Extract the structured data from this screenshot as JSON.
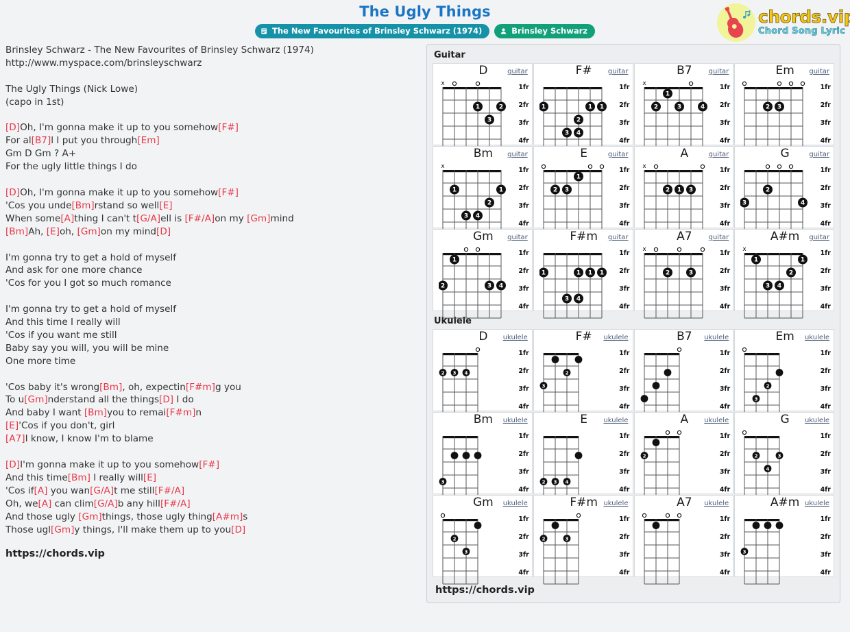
{
  "header": {
    "song_title": "The Ugly Things",
    "album_badge": "The New Favourites of Brinsley Schwarz (1974)",
    "artist_badge": "Brinsley Schwarz",
    "logo_name": "chords.vip",
    "logo_sub": "Chord Song Lyric"
  },
  "lyrics": {
    "footer_url": "https://chords.vip",
    "lines": [
      [
        {
          "t": "Brinsley Schwarz - The New Favourites of Brinsley Schwarz (1974)",
          "c": false
        }
      ],
      [
        {
          "t": "http://www.myspace.com/brinsleyschwarz",
          "c": false
        }
      ],
      [],
      [
        {
          "t": "The Ugly Things (Nick Lowe)",
          "c": false
        }
      ],
      [
        {
          "t": "(capo in 1st)",
          "c": false
        }
      ],
      [],
      [
        {
          "t": "[D]",
          "c": true
        },
        {
          "t": "Oh, I'm gonna make it up to you somehow",
          "c": false
        },
        {
          "t": "[F#]",
          "c": true
        }
      ],
      [
        {
          "t": "For al",
          "c": false
        },
        {
          "t": "[B7]",
          "c": true
        },
        {
          "t": "l I put you through",
          "c": false
        },
        {
          "t": "[Em]",
          "c": true
        }
      ],
      [
        {
          "t": "Gm D Gm ? A+",
          "c": false
        }
      ],
      [
        {
          "t": "For the ugly little things I do",
          "c": false
        }
      ],
      [],
      [
        {
          "t": "[D]",
          "c": true
        },
        {
          "t": "Oh, I'm gonna make it up to you somehow",
          "c": false
        },
        {
          "t": "[F#]",
          "c": true
        }
      ],
      [
        {
          "t": "'Cos you unde",
          "c": false
        },
        {
          "t": "[Bm]",
          "c": true
        },
        {
          "t": "rstand so well",
          "c": false
        },
        {
          "t": "[E]",
          "c": true
        }
      ],
      [
        {
          "t": "When some",
          "c": false
        },
        {
          "t": "[A]",
          "c": true
        },
        {
          "t": "thing I can't t",
          "c": false
        },
        {
          "t": "[G/A]",
          "c": true
        },
        {
          "t": "ell is ",
          "c": false
        },
        {
          "t": "[F#/A]",
          "c": true
        },
        {
          "t": "on my ",
          "c": false
        },
        {
          "t": "[Gm]",
          "c": true
        },
        {
          "t": "mind",
          "c": false
        }
      ],
      [
        {
          "t": "[Bm]",
          "c": true
        },
        {
          "t": "Ah, ",
          "c": false
        },
        {
          "t": "[E]",
          "c": true
        },
        {
          "t": "oh, ",
          "c": false
        },
        {
          "t": "[Gm]",
          "c": true
        },
        {
          "t": "on my mind",
          "c": false
        },
        {
          "t": "[D]",
          "c": true
        }
      ],
      [],
      [
        {
          "t": "I'm gonna try to get a hold of myself",
          "c": false
        }
      ],
      [
        {
          "t": "And ask for one more chance",
          "c": false
        }
      ],
      [
        {
          "t": "'Cos for you I got so much romance",
          "c": false
        }
      ],
      [],
      [
        {
          "t": "I'm gonna try to get a hold of myself",
          "c": false
        }
      ],
      [
        {
          "t": "And this time I really will",
          "c": false
        }
      ],
      [
        {
          "t": "'Cos if you want me still",
          "c": false
        }
      ],
      [
        {
          "t": "Baby say you will, you will be mine",
          "c": false
        }
      ],
      [
        {
          "t": "One more time",
          "c": false
        }
      ],
      [],
      [
        {
          "t": "'Cos baby it's wrong",
          "c": false
        },
        {
          "t": "[Bm]",
          "c": true
        },
        {
          "t": ", oh, expectin",
          "c": false
        },
        {
          "t": "[F#m]",
          "c": true
        },
        {
          "t": "g you",
          "c": false
        }
      ],
      [
        {
          "t": "To u",
          "c": false
        },
        {
          "t": "[Gm]",
          "c": true
        },
        {
          "t": "nderstand all the things",
          "c": false
        },
        {
          "t": "[D]",
          "c": true
        },
        {
          "t": " I do",
          "c": false
        }
      ],
      [
        {
          "t": "And baby I want ",
          "c": false
        },
        {
          "t": "[Bm]",
          "c": true
        },
        {
          "t": "you to remai",
          "c": false
        },
        {
          "t": "[F#m]",
          "c": true
        },
        {
          "t": "n",
          "c": false
        }
      ],
      [
        {
          "t": "[E]",
          "c": true
        },
        {
          "t": "'Cos if you don't, girl",
          "c": false
        }
      ],
      [
        {
          "t": "[A7]",
          "c": true
        },
        {
          "t": "I know, I know I'm to blame",
          "c": false
        }
      ],
      [],
      [
        {
          "t": "[D]",
          "c": true
        },
        {
          "t": "I'm gonna make it up to you somehow",
          "c": false
        },
        {
          "t": "[F#]",
          "c": true
        }
      ],
      [
        {
          "t": "And this time",
          "c": false
        },
        {
          "t": "[Bm]",
          "c": true
        },
        {
          "t": " I really will",
          "c": false
        },
        {
          "t": "[E]",
          "c": true
        }
      ],
      [
        {
          "t": "'Cos if",
          "c": false
        },
        {
          "t": "[A]",
          "c": true
        },
        {
          "t": " you wan",
          "c": false
        },
        {
          "t": "[G/A]",
          "c": true
        },
        {
          "t": "t me still",
          "c": false
        },
        {
          "t": "[F#/A]",
          "c": true
        }
      ],
      [
        {
          "t": "Oh, we",
          "c": false
        },
        {
          "t": "[A]",
          "c": true
        },
        {
          "t": " can clim",
          "c": false
        },
        {
          "t": "[G/A]",
          "c": true
        },
        {
          "t": "b any hill",
          "c": false
        },
        {
          "t": "[F#/A]",
          "c": true
        }
      ],
      [
        {
          "t": "And those ugly ",
          "c": false
        },
        {
          "t": "[Gm]",
          "c": true
        },
        {
          "t": "things, those ugly thing",
          "c": false
        },
        {
          "t": "[A#m]",
          "c": true
        },
        {
          "t": "s",
          "c": false
        }
      ],
      [
        {
          "t": "Those ugl",
          "c": false
        },
        {
          "t": "[Gm]",
          "c": true
        },
        {
          "t": "y things, I'll make them up to you",
          "c": false
        },
        {
          "t": "[D]",
          "c": true
        }
      ]
    ]
  },
  "chords": {
    "guitar_label": "Guitar",
    "ukulele_label": "Ukulele",
    "guitar_tag": "guitar",
    "ukulele_tag": "ukulele",
    "fret_labels": [
      "1fr",
      "2fr",
      "3fr",
      "4fr"
    ],
    "footer_url": "https://chords.vip",
    "guitar": [
      {
        "name": "D",
        "open": [
          "x",
          "o",
          "",
          "o",
          "",
          ""
        ],
        "dots": [
          {
            "s": 3,
            "f": 2,
            "n": "1"
          },
          {
            "s": 5,
            "f": 2,
            "n": "2"
          },
          {
            "s": 4,
            "f": 3,
            "n": "3"
          }
        ]
      },
      {
        "name": "F#",
        "open": [
          "",
          "",
          "",
          "",
          "",
          ""
        ],
        "dots": [
          {
            "s": 0,
            "f": 2,
            "n": "1"
          },
          {
            "s": 4,
            "f": 2,
            "n": "1"
          },
          {
            "s": 5,
            "f": 2,
            "n": "1"
          },
          {
            "s": 3,
            "f": 3,
            "n": "2"
          },
          {
            "s": 2,
            "f": 4,
            "n": "3"
          },
          {
            "s": 3,
            "f": 4,
            "n": "4"
          }
        ]
      },
      {
        "name": "B7",
        "open": [
          "x",
          "",
          "",
          "",
          "o",
          ""
        ],
        "dots": [
          {
            "s": 2,
            "f": 1,
            "n": "1"
          },
          {
            "s": 1,
            "f": 2,
            "n": "2"
          },
          {
            "s": 3,
            "f": 2,
            "n": "3"
          },
          {
            "s": 5,
            "f": 2,
            "n": "4"
          }
        ]
      },
      {
        "name": "Em",
        "open": [
          "o",
          "",
          "",
          "o",
          "o",
          "o"
        ],
        "dots": [
          {
            "s": 2,
            "f": 2,
            "n": "2"
          },
          {
            "s": 3,
            "f": 2,
            "n": "3"
          }
        ]
      },
      {
        "name": "Bm",
        "open": [
          "x",
          "",
          "",
          "",
          "",
          ""
        ],
        "dots": [
          {
            "s": 1,
            "f": 2,
            "n": "1"
          },
          {
            "s": 5,
            "f": 2,
            "n": "1"
          },
          {
            "s": 4,
            "f": 3,
            "n": "2"
          },
          {
            "s": 2,
            "f": 4,
            "n": "3"
          },
          {
            "s": 3,
            "f": 4,
            "n": "4"
          }
        ]
      },
      {
        "name": "E",
        "open": [
          "o",
          "",
          "",
          "",
          "o",
          "o"
        ],
        "dots": [
          {
            "s": 3,
            "f": 1,
            "n": "1"
          },
          {
            "s": 1,
            "f": 2,
            "n": "2"
          },
          {
            "s": 2,
            "f": 2,
            "n": "3"
          }
        ]
      },
      {
        "name": "A",
        "open": [
          "x",
          "o",
          "",
          "",
          "",
          "o"
        ],
        "dots": [
          {
            "s": 2,
            "f": 2,
            "n": "2"
          },
          {
            "s": 3,
            "f": 2,
            "n": "1"
          },
          {
            "s": 4,
            "f": 2,
            "n": "3"
          }
        ]
      },
      {
        "name": "G",
        "open": [
          "",
          "",
          "o",
          "o",
          "o",
          ""
        ],
        "dots": [
          {
            "s": 2,
            "f": 2,
            "n": "2"
          },
          {
            "s": 0,
            "f": 3,
            "n": "3"
          },
          {
            "s": 5,
            "f": 3,
            "n": "4"
          }
        ]
      },
      {
        "name": "Gm",
        "open": [
          "",
          "",
          "o",
          "o",
          "",
          ""
        ],
        "dots": [
          {
            "s": 1,
            "f": 1,
            "n": "1"
          },
          {
            "s": 0,
            "f": 3,
            "n": "2"
          },
          {
            "s": 4,
            "f": 3,
            "n": "3"
          },
          {
            "s": 5,
            "f": 3,
            "n": "4"
          }
        ]
      },
      {
        "name": "F#m",
        "open": [
          "",
          "",
          "",
          "",
          "",
          ""
        ],
        "dots": [
          {
            "s": 0,
            "f": 2,
            "n": "1"
          },
          {
            "s": 3,
            "f": 2,
            "n": "1"
          },
          {
            "s": 4,
            "f": 2,
            "n": "1"
          },
          {
            "s": 5,
            "f": 2,
            "n": "1"
          },
          {
            "s": 2,
            "f": 4,
            "n": "3"
          },
          {
            "s": 3,
            "f": 4,
            "n": "4"
          }
        ]
      },
      {
        "name": "A7",
        "open": [
          "x",
          "o",
          "",
          "o",
          "",
          "o"
        ],
        "dots": [
          {
            "s": 2,
            "f": 2,
            "n": "2"
          },
          {
            "s": 4,
            "f": 2,
            "n": "3"
          }
        ]
      },
      {
        "name": "A#m",
        "open": [
          "x",
          "",
          "",
          "",
          "",
          ""
        ],
        "dots": [
          {
            "s": 1,
            "f": 1,
            "n": "1"
          },
          {
            "s": 5,
            "f": 1,
            "n": "1"
          },
          {
            "s": 4,
            "f": 2,
            "n": "2"
          },
          {
            "s": 2,
            "f": 3,
            "n": "3"
          },
          {
            "s": 3,
            "f": 3,
            "n": "4"
          }
        ]
      }
    ],
    "ukulele": [
      {
        "name": "D",
        "open": [
          "",
          "",
          "",
          "o"
        ],
        "dots": [
          {
            "s": 0,
            "f": 2,
            "n": "2"
          },
          {
            "s": 1,
            "f": 2,
            "n": "3"
          },
          {
            "s": 2,
            "f": 2,
            "n": "4"
          }
        ]
      },
      {
        "name": "F#",
        "open": [
          "",
          "",
          "",
          ""
        ],
        "dots": [
          {
            "s": 1,
            "f": 1,
            "n": ""
          },
          {
            "s": 3,
            "f": 1,
            "n": ""
          },
          {
            "s": 2,
            "f": 2,
            "n": "2"
          },
          {
            "s": 0,
            "f": 3,
            "n": "3"
          }
        ]
      },
      {
        "name": "B7",
        "open": [
          "",
          "",
          "",
          "o"
        ],
        "dots": [
          {
            "s": 2,
            "f": 2,
            "n": ""
          },
          {
            "s": 1,
            "f": 3,
            "n": ""
          },
          {
            "s": 0,
            "f": 4,
            "n": ""
          }
        ]
      },
      {
        "name": "Em",
        "open": [
          "o",
          "",
          "",
          ""
        ],
        "dots": [
          {
            "s": 3,
            "f": 2,
            "n": ""
          },
          {
            "s": 2,
            "f": 3,
            "n": "2"
          },
          {
            "s": 1,
            "f": 4,
            "n": "3"
          }
        ]
      },
      {
        "name": "Bm",
        "open": [
          "",
          "",
          "",
          ""
        ],
        "dots": [
          {
            "s": 1,
            "f": 2,
            "n": ""
          },
          {
            "s": 2,
            "f": 2,
            "n": ""
          },
          {
            "s": 3,
            "f": 2,
            "n": ""
          },
          {
            "s": 0,
            "f": 4,
            "n": "3"
          }
        ]
      },
      {
        "name": "E",
        "open": [
          "",
          "",
          "",
          ""
        ],
        "dots": [
          {
            "s": 3,
            "f": 2,
            "n": ""
          },
          {
            "s": 0,
            "f": 4,
            "n": "2"
          },
          {
            "s": 1,
            "f": 4,
            "n": "3"
          },
          {
            "s": 2,
            "f": 4,
            "n": "4"
          }
        ]
      },
      {
        "name": "A",
        "open": [
          "",
          "",
          "o",
          "o"
        ],
        "dots": [
          {
            "s": 1,
            "f": 1,
            "n": ""
          },
          {
            "s": 0,
            "f": 2,
            "n": "2"
          }
        ]
      },
      {
        "name": "G",
        "open": [
          "o",
          "",
          "",
          ""
        ],
        "dots": [
          {
            "s": 1,
            "f": 2,
            "n": "2"
          },
          {
            "s": 3,
            "f": 2,
            "n": "3"
          },
          {
            "s": 2,
            "f": 3,
            "n": "4"
          }
        ]
      },
      {
        "name": "Gm",
        "open": [
          "o",
          "",
          "",
          ""
        ],
        "dots": [
          {
            "s": 3,
            "f": 1,
            "n": ""
          },
          {
            "s": 1,
            "f": 2,
            "n": "2"
          },
          {
            "s": 2,
            "f": 3,
            "n": "3"
          }
        ]
      },
      {
        "name": "F#m",
        "open": [
          "",
          "",
          "",
          "o"
        ],
        "dots": [
          {
            "s": 1,
            "f": 1,
            "n": ""
          },
          {
            "s": 0,
            "f": 2,
            "n": "2"
          },
          {
            "s": 2,
            "f": 2,
            "n": "3"
          }
        ]
      },
      {
        "name": "A7",
        "open": [
          "o",
          "",
          "o",
          "o"
        ],
        "dots": [
          {
            "s": 1,
            "f": 1,
            "n": ""
          }
        ]
      },
      {
        "name": "A#m",
        "open": [
          "",
          "",
          "",
          ""
        ],
        "dots": [
          {
            "s": 1,
            "f": 1,
            "n": ""
          },
          {
            "s": 2,
            "f": 1,
            "n": ""
          },
          {
            "s": 3,
            "f": 1,
            "n": ""
          },
          {
            "s": 0,
            "f": 3,
            "n": "3"
          }
        ]
      }
    ]
  }
}
